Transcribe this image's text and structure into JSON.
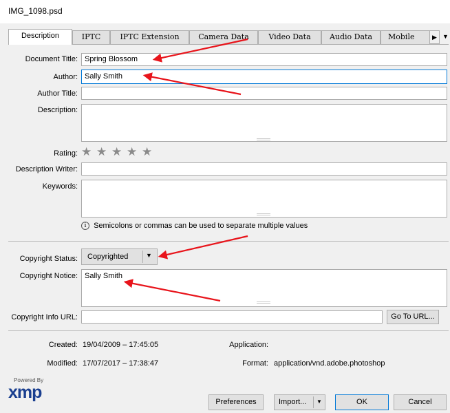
{
  "window": {
    "title": "IMG_1098.psd"
  },
  "tabs": [
    {
      "label": "Description",
      "active": true
    },
    {
      "label": "IPTC",
      "active": false
    },
    {
      "label": "IPTC Extension",
      "active": false
    },
    {
      "label": "Camera Data",
      "active": false
    },
    {
      "label": "Video Data",
      "active": false
    },
    {
      "label": "Audio Data",
      "active": false
    },
    {
      "label": "Mobile SW",
      "active": false
    }
  ],
  "tab_scroll": {
    "right": "▶",
    "menu": "▼"
  },
  "fields": {
    "document_title": {
      "label": "Document Title:",
      "value": "Spring Blossom"
    },
    "author": {
      "label": "Author:",
      "value": "Sally Smith"
    },
    "author_title": {
      "label": "Author Title:",
      "value": ""
    },
    "description": {
      "label": "Description:",
      "value": ""
    },
    "rating": {
      "label": "Rating:",
      "stars": 5,
      "value": 0
    },
    "description_writer": {
      "label": "Description Writer:",
      "value": ""
    },
    "keywords": {
      "label": "Keywords:",
      "value": ""
    },
    "keywords_hint": "Semicolons or commas can be used to separate multiple values",
    "copyright_status": {
      "label": "Copyright Status:",
      "value": "Copyrighted"
    },
    "copyright_notice": {
      "label": "Copyright Notice:",
      "value": "Sally Smith"
    },
    "copyright_url": {
      "label": "Copyright Info URL:",
      "value": ""
    }
  },
  "buttons": {
    "go_to_url": "Go To URL...",
    "preferences": "Preferences",
    "import": "Import...",
    "ok": "OK",
    "cancel": "Cancel"
  },
  "info": {
    "created_label": "Created:",
    "created_value": "19/04/2009 – 17:45:05",
    "modified_label": "Modified:",
    "modified_value": "17/07/2017 – 17:38:47",
    "application_label": "Application:",
    "application_value": "",
    "format_label": "Format:",
    "format_value": "application/vnd.adobe.photoshop"
  },
  "logo": {
    "powered_by": "Powered By",
    "brand": "xmp"
  },
  "colors": {
    "annotation_arrow": "#e8141b",
    "focus_border": "#0078d7",
    "star": "#8a8a8a"
  }
}
